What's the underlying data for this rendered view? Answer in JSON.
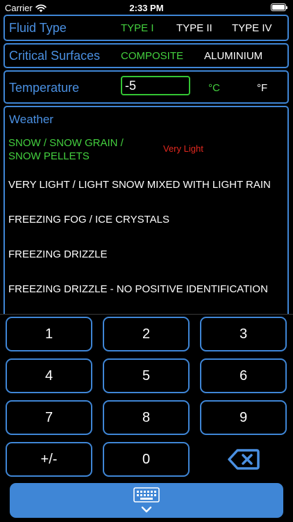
{
  "status": {
    "carrier": "Carrier",
    "time": "2:33 PM"
  },
  "fluid_type": {
    "title": "Fluid Type",
    "options": [
      "TYPE I",
      "TYPE II",
      "TYPE IV"
    ],
    "selected": "TYPE I"
  },
  "critical_surfaces": {
    "title": "Critical Surfaces",
    "options": [
      "COMPOSITE",
      "ALUMINIUM"
    ],
    "selected": "COMPOSITE"
  },
  "temperature": {
    "title": "Temperature",
    "value": "-5",
    "units": [
      "°C",
      "°F"
    ],
    "selected_unit": "°C"
  },
  "weather": {
    "title": "Weather",
    "items": [
      "SNOW / SNOW GRAIN / SNOW PELLETS",
      "VERY LIGHT / LIGHT SNOW MIXED WITH LIGHT RAIN",
      "FREEZING FOG / ICE CRYSTALS",
      "FREEZING DRIZZLE",
      "FREEZING DRIZZLE - NO POSITIVE IDENTIFICATION"
    ],
    "selected_intensity": "Very Light"
  },
  "keypad": {
    "keys": [
      "1",
      "2",
      "3",
      "4",
      "5",
      "6",
      "7",
      "8",
      "9",
      "+/-",
      "0"
    ]
  },
  "colors": {
    "accent_blue": "#3f86d6",
    "title_blue": "#4a90e2",
    "selected_green": "#44d13f",
    "intensity_red": "#e2281f",
    "background": "#000000"
  },
  "icons": [
    "wifi-icon",
    "battery-icon",
    "backspace-icon",
    "keyboard-icon",
    "chevron-down-icon"
  ]
}
